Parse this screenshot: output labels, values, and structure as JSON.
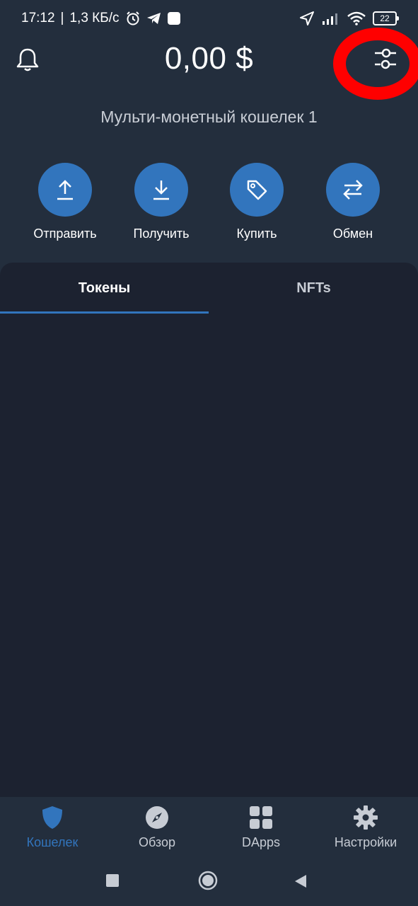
{
  "status_bar": {
    "time": "17:12",
    "network": "1,3 КБ/с",
    "battery": "22"
  },
  "header": {
    "balance": "0,00 $",
    "bell_icon": "bell-icon",
    "filter_icon": "sliders-icon"
  },
  "wallet": {
    "name": "Мульти-монетный кошелек 1"
  },
  "actions": [
    {
      "label": "Отправить",
      "icon": "upload-icon"
    },
    {
      "label": "Получить",
      "icon": "download-icon"
    },
    {
      "label": "Купить",
      "icon": "tag-icon"
    },
    {
      "label": "Обмен",
      "icon": "swap-icon"
    }
  ],
  "tabs": [
    {
      "label": "Токены",
      "active": true
    },
    {
      "label": "NFTs",
      "active": false
    }
  ],
  "bottom_nav": [
    {
      "label": "Кошелек",
      "icon": "shield-icon",
      "active": true
    },
    {
      "label": "Обзор",
      "icon": "compass-icon",
      "active": false
    },
    {
      "label": "DApps",
      "icon": "grid-icon",
      "active": false
    },
    {
      "label": "Настройки",
      "icon": "gear-icon",
      "active": false
    }
  ],
  "colors": {
    "background": "#232e3d",
    "panel": "#1c2230",
    "accent": "#3275bd",
    "annotation": "#ff0000"
  }
}
